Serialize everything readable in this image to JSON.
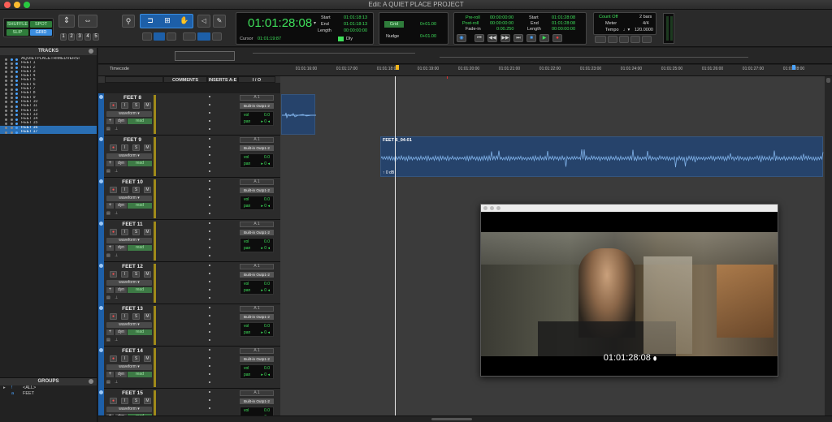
{
  "window": {
    "title": "Edit: A QUIET PLACE PROJECT"
  },
  "colors": {
    "accent": "#1d5fa8",
    "counter_green": "#3ee05a",
    "selection": "#2a6fb4",
    "clip_bg": "#26436b",
    "waveform": "#7fb1e8"
  },
  "toolbar": {
    "modes": {
      "shuffle": "SHUFFLE",
      "spot": "SPOT",
      "slip": "SLIP",
      "grid": "GRID"
    },
    "zoom_presets": [
      "1",
      "2",
      "3",
      "4",
      "5"
    ],
    "main_counter": "01:01:28:08",
    "cursor_label": "Cursor",
    "cursor_value": "01:01:19:87",
    "selection": {
      "start_label": "Start",
      "start": "01:01:18:13",
      "end_label": "End",
      "end": "01:01:18:13",
      "length_label": "Length",
      "length": "00:00:00:00"
    },
    "dly_label": "Dly",
    "grid_label": "Grid",
    "grid_value": "0+01.00",
    "nudge_label": "Nudge",
    "nudge_value": "0+01.00",
    "transport": {
      "preroll_label": "Pre-roll",
      "preroll": "00:00:00:00",
      "postroll_label": "Post-roll",
      "postroll": "00:00:00:00",
      "fadein_label": "Fade-in",
      "fadein": "0:00.250",
      "start_label": "Start",
      "start": "01:01:28:08",
      "end_label": "End",
      "end": "01:01:28:08",
      "length_label": "Length",
      "length": "00:00:00:00"
    },
    "countoff_label": "Count Off",
    "countoff_value": "2 bars",
    "meter_label": "Meter",
    "meter_value": "4/4",
    "tempo_label": "Tempo",
    "tempo_value": "120.0000"
  },
  "tracks_panel": {
    "title": "TRACKS",
    "items": [
      "AQUIETPLACETRIMEDVERSI",
      "FEET 1",
      "FEET 2",
      "FEET 3",
      "FEET 4",
      "FEET 5",
      "FEET 6",
      "FEET 7",
      "FEET 8",
      "FEET 9",
      "FEET 10",
      "FEET 11",
      "FEET 12",
      "FEET 13",
      "FEET 14",
      "FEET 15",
      "FEET 16",
      "FEET 17"
    ],
    "selected": [
      "FEET 16",
      "FEET 17"
    ]
  },
  "groups_panel": {
    "title": "GROUPS",
    "items": [
      {
        "id": "!",
        "name": "<ALL>"
      },
      {
        "id": "a",
        "name": "FEET"
      }
    ]
  },
  "timeline": {
    "ruler_label": "Timecode"
  },
  "ruler_ticks": [
    "01:01:16:00",
    "01:01:17:00",
    "01:01:18:00",
    "01:01:19:00",
    "01:01:20:00",
    "01:01:21:00",
    "01:01:22:00",
    "01:01:23:00",
    "01:01:24:00",
    "01:01:25:00",
    "01:01:26:00",
    "01:01:27:00",
    "01:01:28:00"
  ],
  "columns": {
    "comments": "COMMENTS",
    "inserts": "INSERTS A-E",
    "io": "I / O"
  },
  "track_labels": {
    "record": "●",
    "input": "I",
    "solo": "S",
    "mute": "M",
    "view": "waveform",
    "dyn": "dyn",
    "automation": "read",
    "slot": "A 1",
    "output": "Built-in Outp1-2",
    "vol_label": "vol",
    "pan_label": "pan"
  },
  "tracks": [
    {
      "name": "FEET 8",
      "vol": "0.0",
      "pan": "▸ 0 ◂"
    },
    {
      "name": "FEET 9",
      "vol": "0.0",
      "pan": "▸ 0 ◂"
    },
    {
      "name": "FEET 10",
      "vol": "0.0",
      "pan": "▸ 0 ◂"
    },
    {
      "name": "FEET 11",
      "vol": "0.0",
      "pan": "▸ 0 ◂"
    },
    {
      "name": "FEET 12",
      "vol": "0.0",
      "pan": "▸ 0 ◂"
    },
    {
      "name": "FEET 13",
      "vol": "0.0",
      "pan": "▸ 0 ◂"
    },
    {
      "name": "FEET 14",
      "vol": "0.0",
      "pan": "▸ 0 ◂"
    },
    {
      "name": "FEET 15",
      "vol": "0.0",
      "pan": "▸ 0 ◂"
    }
  ],
  "clips": [
    {
      "name": "FEET 6_04-01",
      "gain": "0 dB"
    }
  ],
  "video_window": {
    "timecode": "01:01:28:08"
  }
}
